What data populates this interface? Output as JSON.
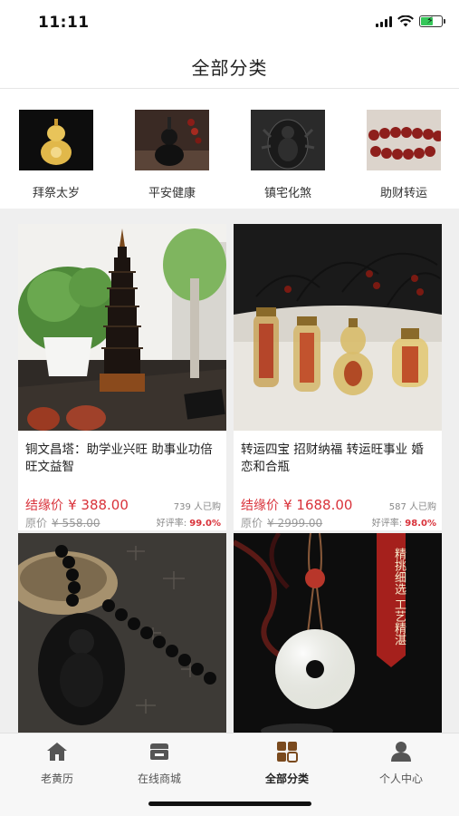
{
  "status_bar": {
    "time": "11:11"
  },
  "header": {
    "title": "全部分类"
  },
  "categories": [
    {
      "label": "拜祭太岁",
      "icon": "gold-gourd-image"
    },
    {
      "label": "平安健康",
      "icon": "black-gourd-image"
    },
    {
      "label": "镇宅化煞",
      "icon": "buddha-pendant-image"
    },
    {
      "label": "助财转运",
      "icon": "red-bead-bracelet-image"
    }
  ],
  "products": [
    {
      "title": "铜文昌塔：助学业兴旺 助事业功倍 旺文益智",
      "price_label": "结缘价",
      "price": "¥ 388.00",
      "sold": "739 人已购",
      "orig_label": "原价",
      "orig_price": "¥ 558.00",
      "rating_label": "好评率:",
      "rating": "99.0%"
    },
    {
      "title": "转运四宝 招财纳福 转运旺事业 婚恋和合瓶",
      "price_label": "结缘价",
      "price": "¥ 1688.00",
      "sold": "587 人已购",
      "orig_label": "原价",
      "orig_price": "¥ 2999.00",
      "rating_label": "好评率:",
      "rating": "98.0%"
    },
    {
      "title": "",
      "image": "obsidian-buddha-pendant"
    },
    {
      "title": "",
      "image": "jade-donut-pendant",
      "banner": "精挑细选 工艺精湛"
    }
  ],
  "tabs": [
    {
      "label": "老黄历",
      "icon": "home-icon",
      "active": false
    },
    {
      "label": "在线商城",
      "icon": "shop-icon",
      "active": false
    },
    {
      "label": "全部分类",
      "icon": "category-grid-icon",
      "active": true
    },
    {
      "label": "个人中心",
      "icon": "person-icon",
      "active": false
    }
  ],
  "colors": {
    "accent": "#d9323a",
    "active_tab": "#7a4a1e",
    "tab_icon": "#555555"
  }
}
